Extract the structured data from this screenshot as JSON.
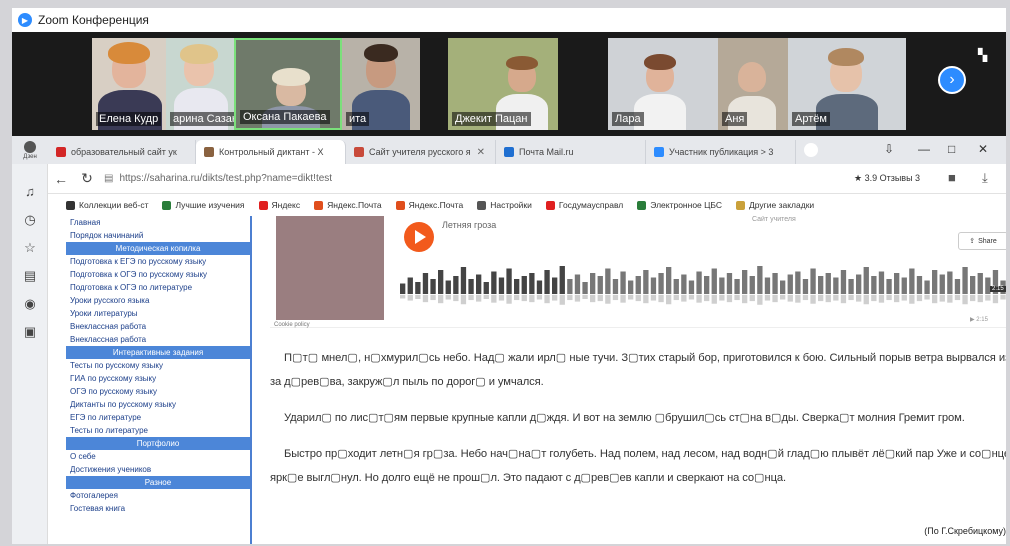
{
  "zoom": {
    "title": "Zoom Конференция",
    "participants": [
      {
        "name": "Елена Кудр"
      },
      {
        "name": "арина Сазан"
      },
      {
        "name": "Оксана Пакаева"
      },
      {
        "name": "ита"
      },
      {
        "name": "Джекит Пацан"
      },
      {
        "name": "Лара"
      },
      {
        "name": "Аня"
      },
      {
        "name": "Артём"
      }
    ]
  },
  "browser": {
    "side_logo": "Дзен",
    "tabs": [
      {
        "label": "образовательный сайт ук",
        "favicon_color": "#d32626"
      },
      {
        "label": "Контрольный диктант - X",
        "favicon_color": "#8a6240",
        "close": "✕",
        "active": true
      },
      {
        "label": "Сайт учителя русского я",
        "favicon_color": "#c84a3a",
        "close": "✕"
      },
      {
        "label": "Почта Mail.ru",
        "favicon_color": "#1f6fd1"
      },
      {
        "label": "Участник публикация > 3",
        "favicon_color": "#2d8cff"
      }
    ],
    "url": "https://saharina.ru/dikts/test.php?name=dikt!test",
    "rating": "★ 3.9 Отзывы 3",
    "bookmarks": [
      {
        "label": "Коллекции веб-ст",
        "color": "#333"
      },
      {
        "label": "Лучшие изучения",
        "color": "#2a7d3a"
      },
      {
        "label": "Яндекс",
        "color": "#e02020"
      },
      {
        "label": "Яндекс.Почта",
        "color": "#e04e1c"
      },
      {
        "label": "Яндекс.Почта",
        "color": "#e04e1c"
      },
      {
        "label": "Настройки",
        "color": "#555"
      },
      {
        "label": "Госдумаусправл",
        "color": "#e02020"
      },
      {
        "label": "Электронное ЦБС",
        "color": "#2a7d3a"
      },
      {
        "label": "Другие закладки",
        "color": "#caa13a"
      }
    ]
  },
  "site_nav": [
    {
      "label": "Главная",
      "type": "link"
    },
    {
      "label": "Порядок начинаний",
      "type": "link"
    },
    {
      "label": "Методическая копилка",
      "type": "head"
    },
    {
      "label": "Подготовка к ЕГЭ по русскому языку",
      "type": "link"
    },
    {
      "label": "Подготовка к ОГЭ по русскому языку",
      "type": "link"
    },
    {
      "label": "Подготовка к ОГЭ по литературе",
      "type": "link"
    },
    {
      "label": "Уроки русского языка",
      "type": "link"
    },
    {
      "label": "Уроки литературы",
      "type": "link"
    },
    {
      "label": "Внеклассная работа",
      "type": "link"
    },
    {
      "label": "Внеклассная работа",
      "type": "link"
    },
    {
      "label": "Интерактивные задания",
      "type": "head"
    },
    {
      "label": "Тесты по русскому языку",
      "type": "link"
    },
    {
      "label": "ГИА по русскому языку",
      "type": "link"
    },
    {
      "label": "ОГЭ по русскому языку",
      "type": "link"
    },
    {
      "label": "Диктанты по русскому языку",
      "type": "link"
    },
    {
      "label": "ЕГЭ по литературе",
      "type": "link"
    },
    {
      "label": "Тесты по литературе",
      "type": "link"
    },
    {
      "label": "Портфолио",
      "type": "head"
    },
    {
      "label": "О себе",
      "type": "link"
    },
    {
      "label": "Достижения учеников",
      "type": "link"
    },
    {
      "label": "Разное",
      "type": "head"
    },
    {
      "label": "Фотогалерея",
      "type": "link"
    },
    {
      "label": "Гостевая книга",
      "type": "link"
    }
  ],
  "audio": {
    "title": "Летняя гроза",
    "artist": "Сайт учителя",
    "share_label": "Share",
    "duration": "2:15",
    "cover_caption": "Cookie policy",
    "footer": "▶ 2:15",
    "waveform": [
      0.35,
      0.55,
      0.4,
      0.7,
      0.5,
      0.8,
      0.45,
      0.6,
      0.9,
      0.5,
      0.65,
      0.4,
      0.75,
      0.55,
      0.85,
      0.5,
      0.6,
      0.7,
      0.45,
      0.8,
      0.55,
      0.95,
      0.5,
      0.65,
      0.4,
      0.7,
      0.6,
      0.85,
      0.5,
      0.75,
      0.45,
      0.6,
      0.8,
      0.55,
      0.7,
      0.9,
      0.5,
      0.65,
      0.45,
      0.75,
      0.6,
      0.85,
      0.55,
      0.7,
      0.5,
      0.8,
      0.6,
      0.95,
      0.55,
      0.7,
      0.45,
      0.65,
      0.75,
      0.5,
      0.85,
      0.6,
      0.7,
      0.55,
      0.8,
      0.5,
      0.65,
      0.9,
      0.6,
      0.75,
      0.5,
      0.7,
      0.55,
      0.85,
      0.6,
      0.45,
      0.8,
      0.65,
      0.75,
      0.5,
      0.9,
      0.6,
      0.7,
      0.55,
      0.8,
      0.45
    ],
    "played_fraction": 0.28
  },
  "dictation": {
    "paragraphs": [
      "П▢т▢ мнел▢, н▢хмурил▢сь небо. Над▢ жали ирл▢ ные тучи. З▢тих старый бор, приготовился к бою. Сильный порыв ветра вырвался из за д▢рев▢ва, закруж▢л пыль по дорог▢ и умчался.",
      "Ударил▢ по лис▢т▢ям первые крупные капли д▢ждя. И вот на землю ▢брушил▢сь ст▢на в▢ды. Сверка▢т молния Гремит гром.",
      "Быстро пр▢ходит летн▢я гр▢за. Небо нач▢на▢т голубеть. Над полем, над лесом, над водн▢й глад▢ю плывёт лё▢кий пар Уже и со▢нце ярк▢е выгл▢нул. Но долго ещё не прош▢л. Это падают с д▢рев▢ев капли и сверкают на со▢нца."
    ],
    "author": "(По Г.Скребицкому)"
  }
}
